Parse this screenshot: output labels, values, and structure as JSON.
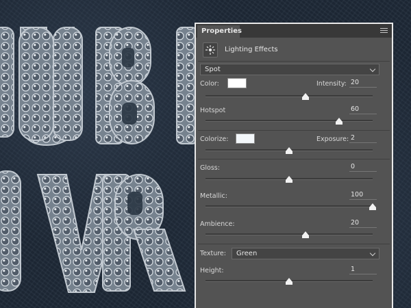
{
  "panel": {
    "tab_title": "Properties",
    "menu_icon": "panel-menu-icon",
    "section_icon": "lighting-effects-icon",
    "section_title": "Lighting Effects"
  },
  "light": {
    "type_selected": "Spot"
  },
  "controls": {
    "color": {
      "label": "Color:",
      "swatch": "#ffffff"
    },
    "intensity": {
      "label": "Intensity:",
      "value": "20",
      "position": 0.6
    },
    "hotspot": {
      "label": "Hotspot",
      "value": "60",
      "position": 0.8
    },
    "colorize": {
      "label": "Colorize:",
      "swatch": "#f3f7fa"
    },
    "exposure": {
      "label": "Exposure:",
      "value": "2",
      "position": 0.5
    },
    "gloss": {
      "label": "Gloss:",
      "value": "0",
      "position": 0.5
    },
    "metallic": {
      "label": "Metallic:",
      "value": "100",
      "position": 1.0
    },
    "ambience": {
      "label": "Ambience:",
      "value": "20",
      "position": 0.6
    },
    "texture": {
      "label": "Texture:",
      "selected": "Green"
    },
    "height": {
      "label": "Height:",
      "value": "1",
      "position": 0.5
    }
  },
  "colors": {
    "panel_bg": "#535353",
    "panel_border": "#e9e9e9",
    "canvas_bg": "#1f2a38"
  }
}
